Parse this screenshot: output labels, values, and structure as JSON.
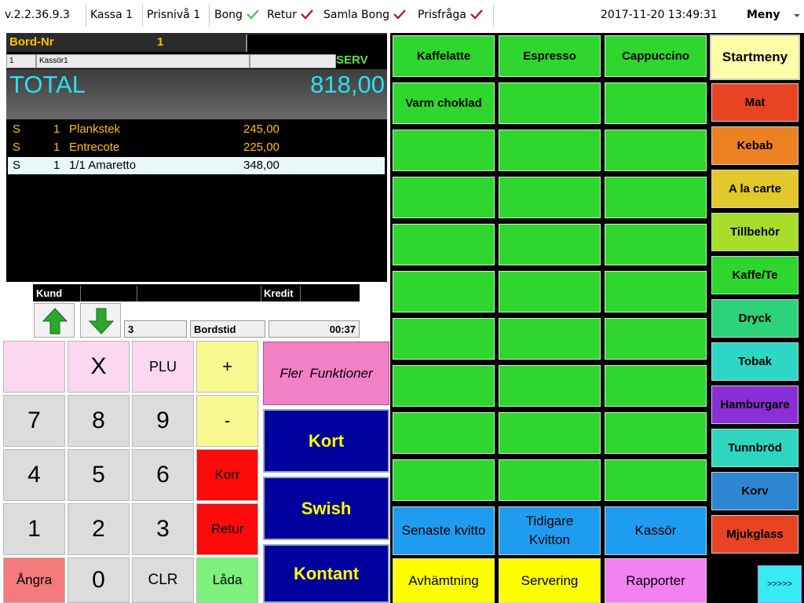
{
  "topbar": {
    "version": "v.2.2.36.9.3",
    "register": "Kassa 1",
    "price_level": "Prisnivå 1",
    "toggles": [
      {
        "label": "Bong",
        "checked": true,
        "check_color": "#4cc04c"
      },
      {
        "label": "Retur",
        "checked": true,
        "check_color": "#c0002a"
      },
      {
        "label": "Samla Bong",
        "checked": true,
        "check_color": "#c0002a"
      },
      {
        "label": "Prisfråga",
        "checked": true,
        "check_color": "#c0002a"
      }
    ],
    "datetime": "2017-11-20  13:49:31",
    "menu_label": "Meny"
  },
  "order": {
    "table_label": "Bord-Nr",
    "table_number": "1",
    "cashier_id": "1",
    "cashier_name": "Kassör1",
    "mode": "SERV",
    "total_label": "TOTAL",
    "total_value": "818,00",
    "lines": [
      {
        "flag": "S",
        "qty": "1",
        "name": "Plankstek",
        "price": "245,00",
        "selected": false
      },
      {
        "flag": "S",
        "qty": "1",
        "name": "Entrecote",
        "price": "225,00",
        "selected": false
      },
      {
        "flag": "S",
        "qty": "1",
        "name": "1/1 Amaretto",
        "price": "348,00",
        "selected": true
      }
    ]
  },
  "customer": {
    "customer_label": "Kund",
    "credit_label": "Kredit",
    "guests": "3",
    "table_time_label": "Bordstid",
    "table_time": "00:37"
  },
  "keypad": {
    "x": "X",
    "plu": "PLU",
    "plus": "+",
    "minus": "-",
    "seven": "7",
    "eight": "8",
    "nine": "9",
    "four": "4",
    "five": "5",
    "six": "6",
    "one": "1",
    "two": "2",
    "three": "3",
    "zero": "0",
    "clr": "CLR",
    "korr": "Korr",
    "retur": "Retur",
    "angra": "Ångra",
    "lada": "Låda"
  },
  "payment": {
    "more_functions": "Fler  Funktioner",
    "card": "Kort",
    "swish": "Swish",
    "cash": "Kontant"
  },
  "products": {
    "kaffelatte": "Kaffelatte",
    "espresso": "Espresso",
    "cappuccino": "Cappuccino",
    "varm_choklad": "Varm choklad"
  },
  "functions": {
    "latest_receipt": "Senaste kvitto",
    "earlier_receipts": "Tidigare Kvitton",
    "cashier": "Kassör",
    "pickup": "Avhämtning",
    "serving": "Servering",
    "reports": "Rapporter"
  },
  "categories": {
    "start": "Startmeny",
    "items": [
      {
        "label": "Mat",
        "color": "#e84424"
      },
      {
        "label": "Kebab",
        "color": "#ec8222"
      },
      {
        "label": "A la carte",
        "color": "#e2c82a"
      },
      {
        "label": "Tillbehör",
        "color": "#a8de2a"
      },
      {
        "label": "Kaffe/Te",
        "color": "#2ed62e"
      },
      {
        "label": "Dryck",
        "color": "#2ed27a"
      },
      {
        "label": "Tobak",
        "color": "#2ed6c6"
      },
      {
        "label": "Hamburgare",
        "color": "#8a2ed6"
      },
      {
        "label": "Tunnbröd",
        "color": "#2ed6c2"
      },
      {
        "label": "Korv",
        "color": "#2e86d2"
      },
      {
        "label": "Mjukglass",
        "color": "#e84424"
      }
    ],
    "next": ">>>>>"
  },
  "colors": {
    "accent_yellow": "#ffc000",
    "total_cyan": "#2be0f0",
    "product_green": "#2ed62e",
    "pay_blue": "#00009c"
  }
}
